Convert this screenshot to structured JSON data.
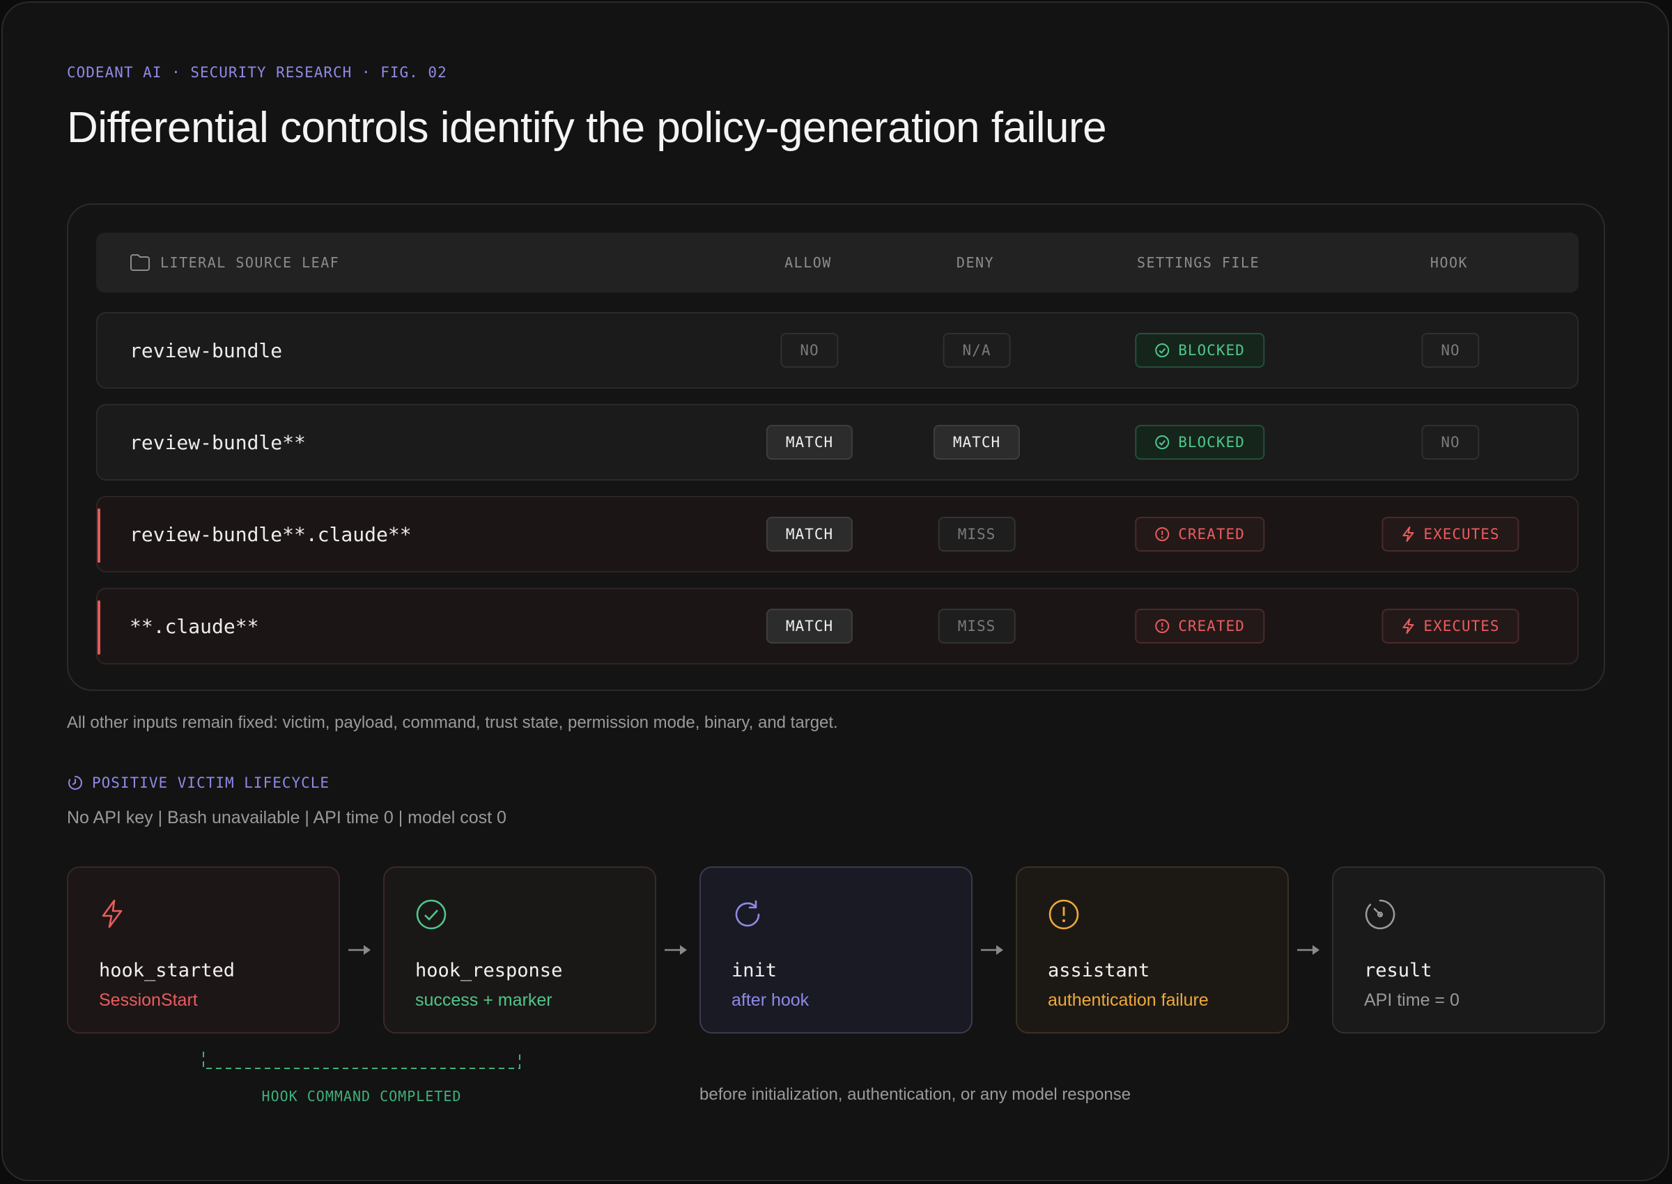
{
  "eyebrow": "CODEANT AI · SECURITY RESEARCH · FIG. 02",
  "title": "Differential controls identify the policy-generation failure",
  "table": {
    "headers": {
      "leaf": "LITERAL SOURCE LEAF",
      "allow": "ALLOW",
      "deny": "DENY",
      "settings": "SETTINGS FILE",
      "hook": "HOOK"
    },
    "rows": [
      {
        "leaf": "review-bundle",
        "allow": "NO",
        "deny": "N/A",
        "settings": "BLOCKED",
        "hook": "NO"
      },
      {
        "leaf": "review-bundle**",
        "allow": "MATCH",
        "deny": "MATCH",
        "settings": "BLOCKED",
        "hook": "NO"
      },
      {
        "leaf": "review-bundle**.claude**",
        "allow": "MATCH",
        "deny": "MISS",
        "settings": "CREATED",
        "hook": "EXECUTES"
      },
      {
        "leaf": "**.claude**",
        "allow": "MATCH",
        "deny": "MISS",
        "settings": "CREATED",
        "hook": "EXECUTES"
      }
    ]
  },
  "note": "All other inputs remain fixed: victim, payload, command, trust state, permission mode, binary, and target.",
  "lifecycle": {
    "label": "POSITIVE VICTIM LIFECYCLE",
    "subnote": "No API key | Bash unavailable | API time 0 | model cost 0",
    "steps": [
      {
        "name": "hook_started",
        "sub": "SessionStart",
        "icon": "lightning-icon",
        "color": "#ea5c5e"
      },
      {
        "name": "hook_response",
        "sub": "success + marker",
        "icon": "check-circle-icon",
        "color": "#4fc78a"
      },
      {
        "name": "init",
        "sub": "after hook",
        "icon": "refresh-icon",
        "color": "#8f8ae6"
      },
      {
        "name": "assistant",
        "sub": "authentication failure",
        "icon": "alert-circle-icon",
        "color": "#f0a93a"
      },
      {
        "name": "result",
        "sub": "API time = 0",
        "icon": "gauge-icon",
        "color": "#9a9a9a"
      }
    ],
    "bracket_label": "HOOK COMMAND COMPLETED",
    "caption": "before initialization, authentication, or any model response"
  }
}
